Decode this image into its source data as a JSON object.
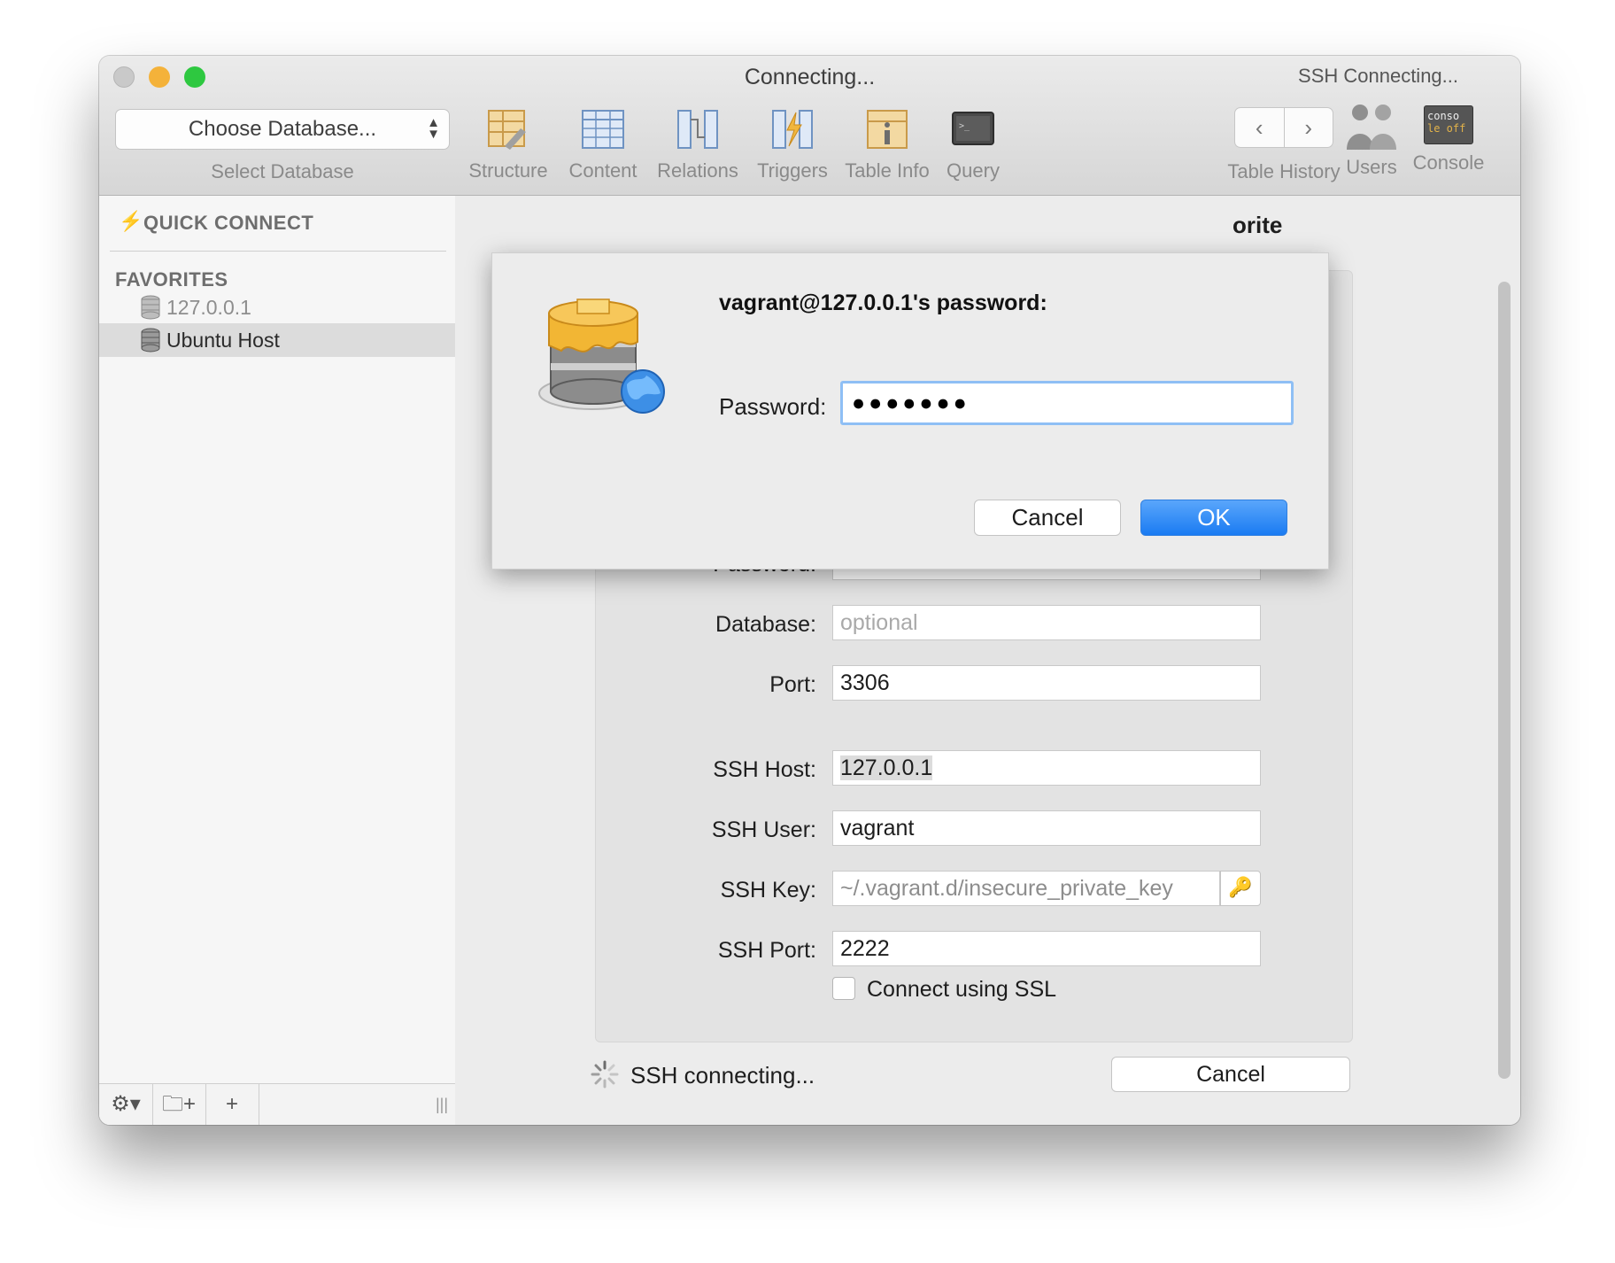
{
  "window": {
    "title": "Connecting...",
    "ssh_status": "SSH Connecting..."
  },
  "toolbar": {
    "database_select": "Choose Database...",
    "database_select_label": "Select Database",
    "tools": [
      {
        "label": "Structure",
        "icon": "structure-icon"
      },
      {
        "label": "Content",
        "icon": "content-icon"
      },
      {
        "label": "Relations",
        "icon": "relations-icon"
      },
      {
        "label": "Triggers",
        "icon": "triggers-icon"
      },
      {
        "label": "Table Info",
        "icon": "table-info-icon"
      },
      {
        "label": "Query",
        "icon": "query-icon"
      }
    ],
    "history_label": "Table History",
    "back_glyph": "‹",
    "forward_glyph": "›",
    "users_label": "Users",
    "console_label": "Console",
    "console_icon_text_1": "conso",
    "console_icon_text_2": "le off"
  },
  "sidebar": {
    "quick_connect": "QUICK CONNECT",
    "favorites_header": "FAVORITES",
    "favorites": [
      {
        "label": "127.0.0.1",
        "selected": false
      },
      {
        "label": "Ubuntu Host",
        "selected": true
      }
    ]
  },
  "main": {
    "heading_fragment": "orite",
    "fields": [
      {
        "label": "Password:",
        "value": "●●●●●●●●",
        "placeholder": false
      },
      {
        "label": "Database:",
        "value": "optional",
        "placeholder": true
      },
      {
        "label": "Port:",
        "value": "3306",
        "placeholder": false
      },
      {
        "label": "SSH Host:",
        "value": "127.0.0.1",
        "placeholder": false
      },
      {
        "label": "SSH User:",
        "value": "vagrant",
        "placeholder": false
      },
      {
        "label": "SSH Key:",
        "value": "~/.vagrant.d/insecure_private_key",
        "placeholder": true
      },
      {
        "label": "SSH Port:",
        "value": "2222",
        "placeholder": false
      }
    ],
    "ssl_checkbox_label": "Connect using SSL",
    "ssl_checked": false,
    "status_text": "SSH connecting...",
    "cancel_button": "Cancel"
  },
  "dialog": {
    "title": "vagrant@127.0.0.1's password:",
    "password_label": "Password:",
    "password_value": "●●●●●●●",
    "cancel_button": "Cancel",
    "ok_button": "OK"
  },
  "colors": {
    "accent": "#1a7bf2",
    "focus_ring": "#8fbff5",
    "close": "#c9c9c9",
    "minimize": "#f4b23a",
    "zoom": "#2ec840"
  }
}
